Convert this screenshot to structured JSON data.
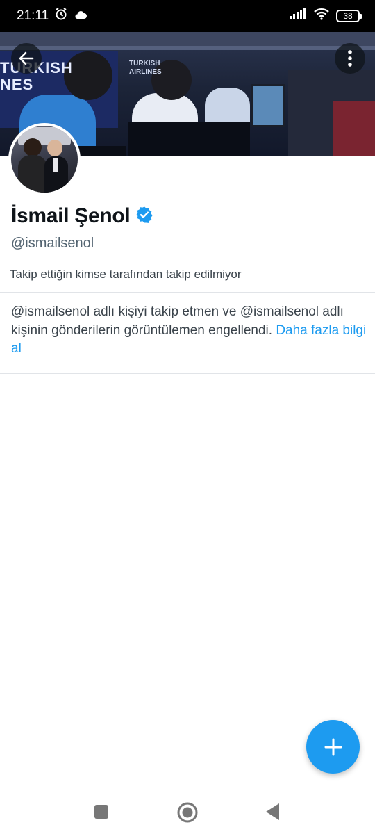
{
  "status_bar": {
    "time": "21:11",
    "battery": "38",
    "icons": [
      "alarm-icon",
      "cloud-icon",
      "signal-icon",
      "wifi-icon",
      "battery-icon"
    ]
  },
  "banner": {
    "left_text_line1": "TURKISH",
    "left_text_line2": "NES",
    "logo_line1": "TURKISH",
    "logo_line2": "AIRLINES"
  },
  "profile": {
    "display_name": "İsmail Şenol",
    "handle": "@ismailsenol",
    "followed_by": "Takip ettiğin kimse tarafından takip edilmiyor",
    "verified_color": "#1d9bf0"
  },
  "blocked_notice": {
    "message": "@ismailsenol adlı kişiyi takip etmen ve @ismailsenol adlı kişinin gönderilerin görüntülemen engellendi.",
    "learn_more": "Daha fazla bilgi al",
    "link_color": "#1d9bf0"
  },
  "fab": {
    "icon": "plus-icon"
  },
  "nav_bar": {
    "icons": [
      "recents-icon",
      "home-icon",
      "back-icon"
    ]
  }
}
